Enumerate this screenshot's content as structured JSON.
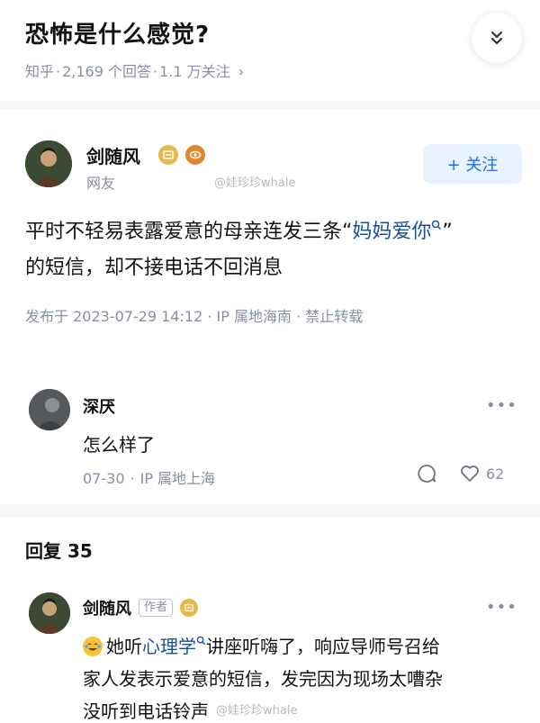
{
  "question": {
    "title": "恐怖是什么感觉?",
    "source": "知乎",
    "answers_count": "2,169 个回答",
    "followers": "1.1 万关注",
    "meta_chevron": "›"
  },
  "author": {
    "name": "剑随风",
    "subtitle": "网友",
    "follow_label": "+ 关注"
  },
  "watermark": "@娃珍珍whale",
  "answer": {
    "line1_prefix": "平时不轻易表露爱意的母亲连发三条“",
    "link": "妈妈爱你",
    "line1_suffix": "”",
    "line2": "的短信，却不接电话不回消息",
    "meta": "发布于 2023-07-29 14:12 · IP 属地海南 · 禁止转载"
  },
  "comment1": {
    "name": "深厌",
    "text": "怎么样了",
    "date": "07-30",
    "ip": "IP 属地上海",
    "likes": "62",
    "more": "•••"
  },
  "replies": {
    "header": "回复 35"
  },
  "reply1": {
    "name": "剑随风",
    "tag": "作者",
    "text_prefix": "她听",
    "link": "心理学",
    "text_suffix": "讲座听嗨了，响应导师号召给",
    "line2": "家人发表示爱意的短信，发完因为现场太嘈杂",
    "line3": "没听到电话铃声",
    "more": "•••"
  },
  "colors": {
    "accent": "#1772f6",
    "link": "#175199",
    "meta": "#8590a6",
    "badge_gold": "#e0a43a"
  }
}
